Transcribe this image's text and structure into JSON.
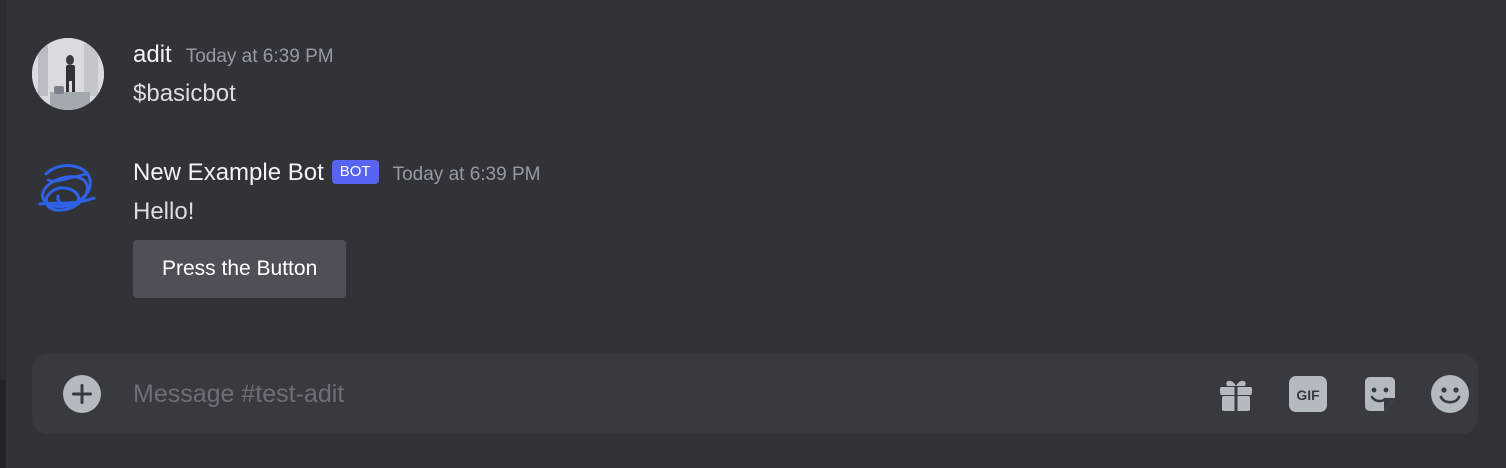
{
  "messages": [
    {
      "username": "adit",
      "timestamp": "Today at 6:39 PM",
      "content": "$basicbot"
    },
    {
      "username": "New Example Bot",
      "tag": "BOT",
      "timestamp": "Today at 6:39 PM",
      "content": "Hello!",
      "button_label": "Press the Button"
    }
  ],
  "composer": {
    "placeholder": "Message #test-adit",
    "icons": [
      "add-icon",
      "gift-icon",
      "gif-icon",
      "sticker-icon",
      "emoji-icon"
    ],
    "gif_label": "GIF"
  },
  "colors": {
    "background": "#313338",
    "composer": "#383a40",
    "bot_tag": "#5865f2",
    "button": "#4e5058",
    "icon": "#b5bac1",
    "bot_avatar_scribble": "#2f62e8"
  }
}
